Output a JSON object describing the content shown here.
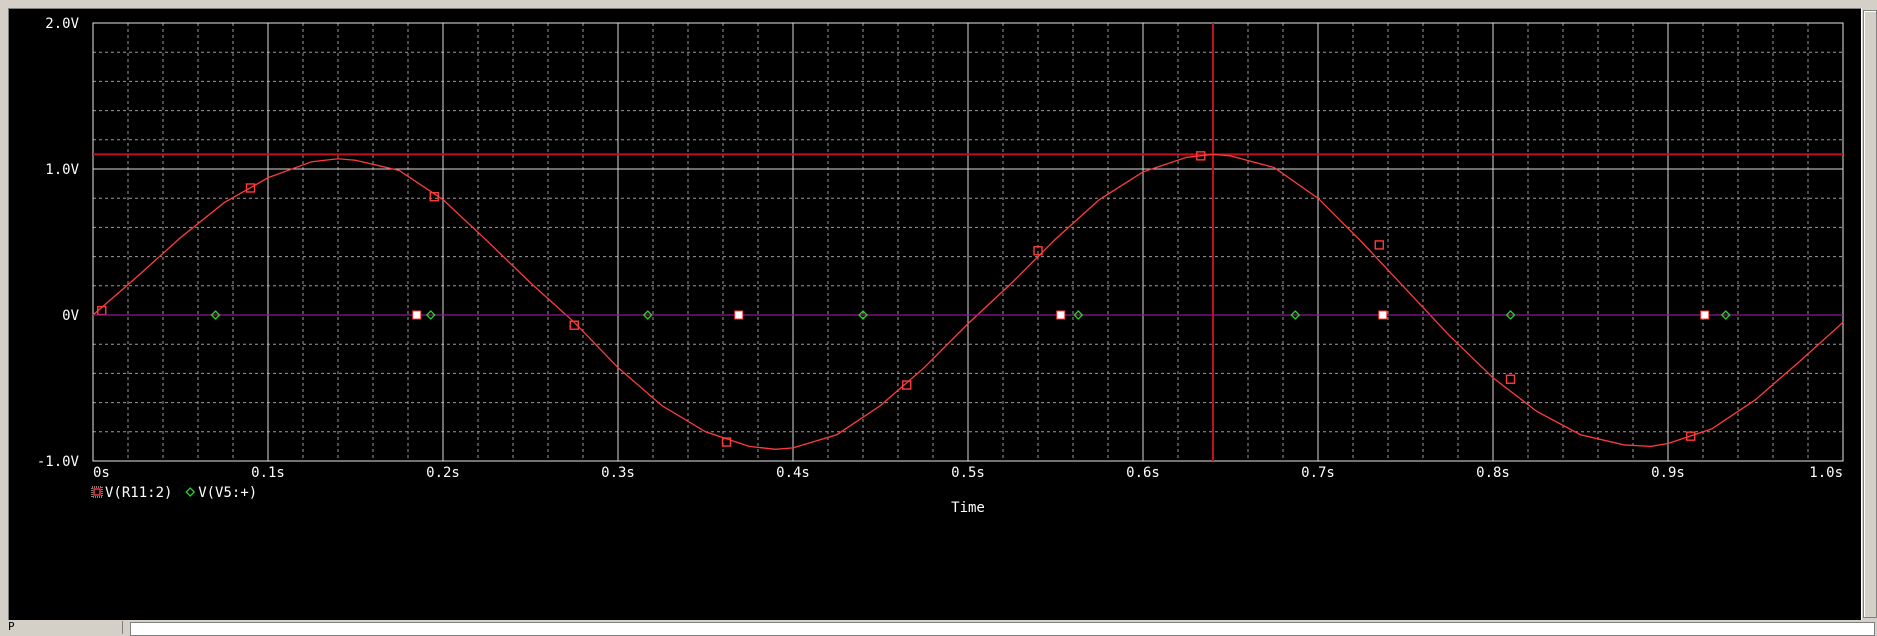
{
  "chart_data": {
    "type": "line",
    "xlabel": "Time",
    "ylabel": "",
    "xlim": [
      0,
      1.0
    ],
    "ylim": [
      -1.0,
      2.0
    ],
    "x_ticks": [
      {
        "v": 0.0,
        "label": "0s"
      },
      {
        "v": 0.1,
        "label": "0.1s"
      },
      {
        "v": 0.2,
        "label": "0.2s"
      },
      {
        "v": 0.3,
        "label": "0.3s"
      },
      {
        "v": 0.4,
        "label": "0.4s"
      },
      {
        "v": 0.5,
        "label": "0.5s"
      },
      {
        "v": 0.6,
        "label": "0.6s"
      },
      {
        "v": 0.7,
        "label": "0.7s"
      },
      {
        "v": 0.8,
        "label": "0.8s"
      },
      {
        "v": 0.9,
        "label": "0.9s"
      },
      {
        "v": 1.0,
        "label": "1.0s"
      }
    ],
    "y_ticks": [
      {
        "v": 2.0,
        "label": "2.0V"
      },
      {
        "v": 1.0,
        "label": "1.0V"
      },
      {
        "v": 0.0,
        "label": "0V"
      },
      {
        "v": -1.0,
        "label": "-1.0V"
      }
    ],
    "grid": true,
    "series": [
      {
        "name": "V(R11:2)",
        "color": "#ff3c3c",
        "marker": "square",
        "x": [
          0.0,
          0.025,
          0.05,
          0.075,
          0.1,
          0.125,
          0.14,
          0.15,
          0.175,
          0.2,
          0.225,
          0.25,
          0.275,
          0.3,
          0.325,
          0.35,
          0.375,
          0.39,
          0.4,
          0.425,
          0.45,
          0.475,
          0.5,
          0.525,
          0.55,
          0.575,
          0.6,
          0.625,
          0.64,
          0.65,
          0.675,
          0.7,
          0.725,
          0.75,
          0.775,
          0.8,
          0.825,
          0.85,
          0.875,
          0.89,
          0.9,
          0.925,
          0.95,
          0.975,
          1.0
        ],
        "y": [
          0.0,
          0.26,
          0.53,
          0.77,
          0.94,
          1.05,
          1.07,
          1.06,
          0.99,
          0.79,
          0.51,
          0.22,
          -0.05,
          -0.36,
          -0.62,
          -0.8,
          -0.9,
          -0.92,
          -0.91,
          -0.82,
          -0.62,
          -0.36,
          -0.06,
          0.22,
          0.52,
          0.79,
          0.98,
          1.08,
          1.1,
          1.09,
          1.01,
          0.8,
          0.5,
          0.18,
          -0.14,
          -0.43,
          -0.66,
          -0.82,
          -0.89,
          -0.9,
          -0.88,
          -0.78,
          -0.58,
          -0.32,
          -0.05
        ],
        "markers_x": [
          0.005,
          0.09,
          0.195,
          0.275,
          0.362,
          0.465,
          0.54,
          0.633,
          0.735,
          0.81,
          0.913
        ],
        "markers_y": [
          0.03,
          0.87,
          0.81,
          -0.07,
          -0.87,
          -0.48,
          0.44,
          1.09,
          0.48,
          -0.44,
          -0.83
        ]
      },
      {
        "name": "V(V5:+)",
        "color": "#8b1a8b",
        "marker": "diamond",
        "marker_color": "#29d129",
        "x": [
          0.0,
          1.0
        ],
        "y": [
          0.0,
          0.0
        ],
        "markers_x": [
          0.07,
          0.193,
          0.317,
          0.44,
          0.563,
          0.687,
          0.81,
          0.933
        ],
        "markers_y": [
          0,
          0,
          0,
          0,
          0,
          0,
          0,
          0
        ]
      }
    ],
    "cursor": {
      "x": 0.64,
      "y": 1.1,
      "color": "#c01020"
    },
    "extra_markers": {
      "color": "#ffffff",
      "x": [
        0.185,
        0.369,
        0.553,
        0.737,
        0.921
      ],
      "y": [
        0,
        0,
        0,
        0,
        0
      ]
    },
    "legend": [
      {
        "label": "V(R11:2)",
        "marker": "square",
        "color": "#ff3c3c"
      },
      {
        "label": "V(V5:+)",
        "marker": "diamond",
        "color": "#29d129"
      }
    ]
  },
  "statusbar": {
    "tab_label": "P"
  }
}
